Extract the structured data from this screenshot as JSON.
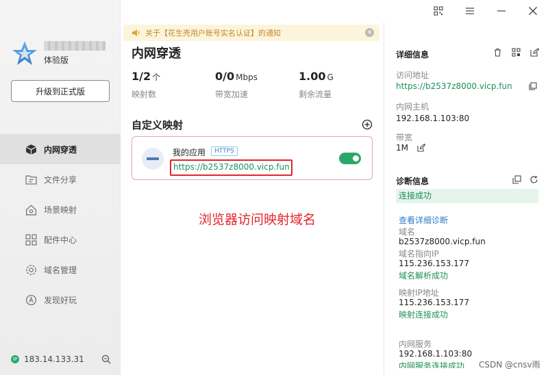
{
  "window": {
    "controls": [
      "qr-icon",
      "menu-icon",
      "minimize-icon",
      "close-icon"
    ]
  },
  "sidebar": {
    "edition": "体验版",
    "upgrade_label": "升级到正式版",
    "items": [
      {
        "label": "内网穿透",
        "icon": "cube-icon",
        "active": true
      },
      {
        "label": "文件分享",
        "icon": "folder-share-icon",
        "active": false
      },
      {
        "label": "场景映射",
        "icon": "home-scene-icon",
        "active": false
      },
      {
        "label": "配件中心",
        "icon": "grid-icon",
        "active": false
      },
      {
        "label": "域名管理",
        "icon": "gear-domain-icon",
        "active": false
      },
      {
        "label": "发现好玩",
        "icon": "discover-icon",
        "active": false
      }
    ],
    "ip": "183.14.133.31"
  },
  "notice": "关于【花生壳用户账号实名认证】的通知",
  "main": {
    "title": "内网穿透",
    "stats": [
      {
        "value": "1/2",
        "unit": "个",
        "label": "映射数"
      },
      {
        "value": "0/0",
        "unit": "Mbps",
        "label": "带宽加速"
      },
      {
        "value": "1.00",
        "unit": "G",
        "label": "剩余流量"
      }
    ],
    "section_title": "自定义映射",
    "mapping": {
      "name": "我的应用",
      "protocol": "HTTPS",
      "url": "https://b2537z8000.vicp.fun",
      "enabled": true
    },
    "annotation": "浏览器访问映射域名"
  },
  "detail": {
    "title": "详细信息",
    "access_label": "访问地址",
    "access_url": "https://b2537z8000.vicp.fun",
    "host_label": "内网主机",
    "host_value": "192.168.1.103:80",
    "bandwidth_label": "带宽",
    "bandwidth_value": "1M",
    "diag_title": "诊断信息",
    "diag_status": "连接成功",
    "diag_link": "查看详细诊断",
    "domain_label": "域名",
    "domain_value": "b2537z8000.vicp.fun",
    "domain_ip_label": "域名指向IP",
    "domain_ip_value": "115.236.153.177",
    "domain_ok": "域名解析成功",
    "map_ip_label": "映射IP地址",
    "map_ip_value": "115.236.153.177",
    "map_ok": "映射连接成功",
    "lan_label": "内网服务",
    "lan_value": "192.168.1.103:80",
    "lan_ok": "内网服务连接成功"
  },
  "watermark": "CSDN @cnsv雨",
  "colors": {
    "accent_green": "#2aa86b",
    "highlight_red": "#e0242a",
    "link_green": "#1e8f5a"
  }
}
